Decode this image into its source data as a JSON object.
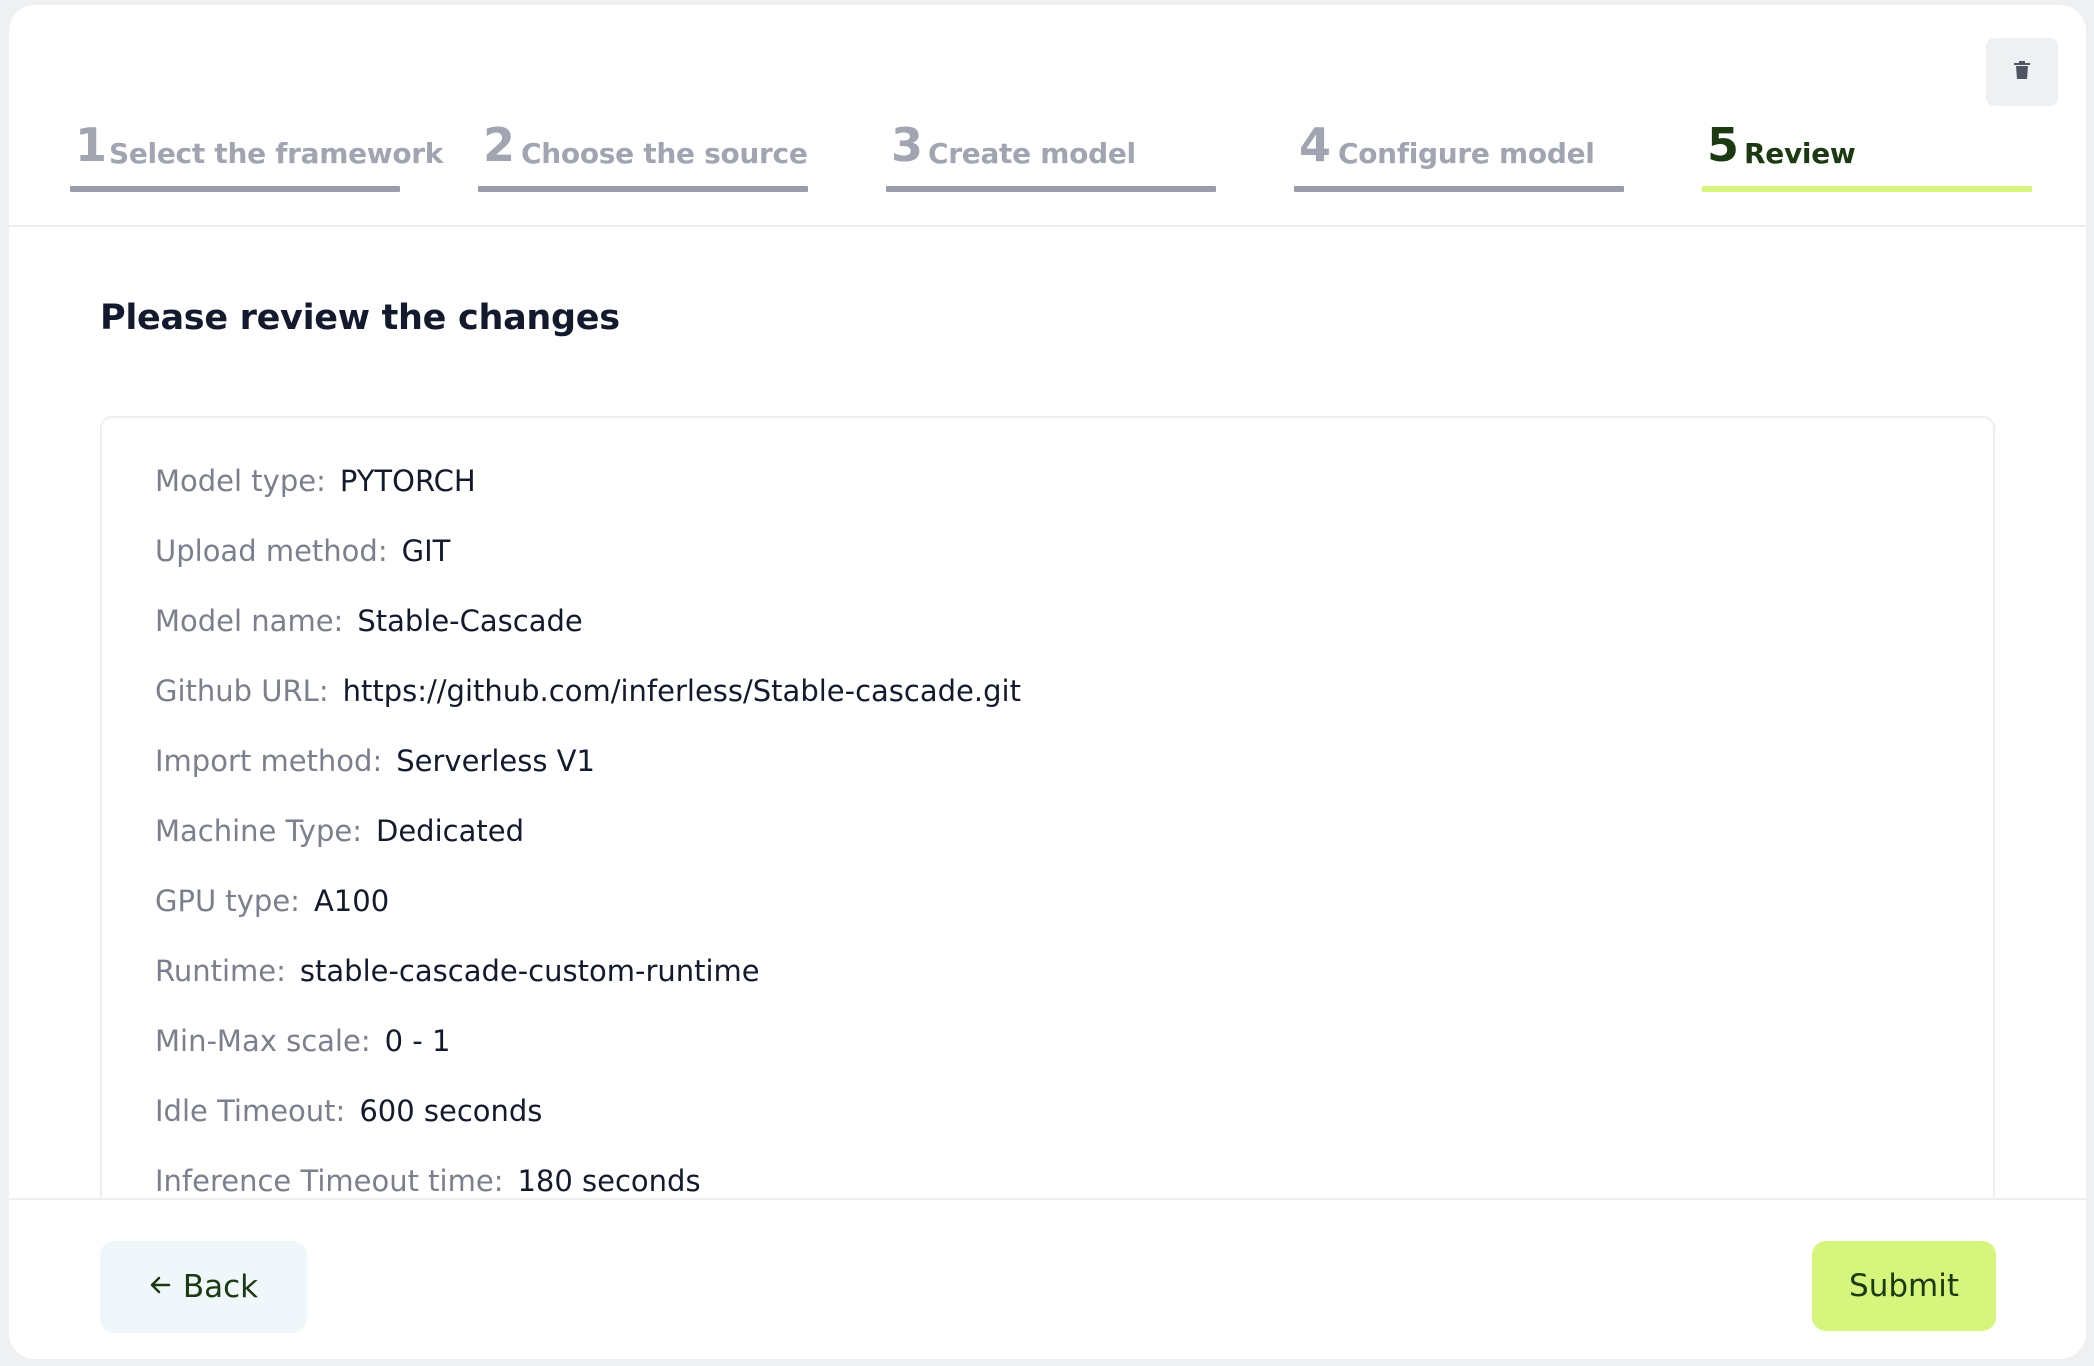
{
  "steps": [
    {
      "number": "1",
      "label": "Select the framework",
      "active": false
    },
    {
      "number": "2",
      "label": "Choose the source",
      "active": false
    },
    {
      "number": "3",
      "label": "Create model",
      "active": false
    },
    {
      "number": "4",
      "label": "Configure model",
      "active": false
    },
    {
      "number": "5",
      "label": "Review",
      "active": true
    }
  ],
  "icons": {
    "delete": "trash-icon",
    "back": "arrow-left-icon"
  },
  "colors": {
    "accent": "#d6f57c",
    "accent_text": "#1c3a12",
    "inactive_step": "#a1a5b2",
    "label_gray": "#7b7f8e"
  },
  "review": {
    "title": "Please review the changes",
    "fields": [
      {
        "key": "Model type:",
        "value": "PYTORCH"
      },
      {
        "key": "Upload method:",
        "value": "GIT"
      },
      {
        "key": "Model name:",
        "value": "Stable-Cascade"
      },
      {
        "key": "Github URL:",
        "value": "https://github.com/inferless/Stable-cascade.git"
      },
      {
        "key": "Import method:",
        "value": "Serverless V1"
      },
      {
        "key": "Machine Type:",
        "value": "Dedicated"
      },
      {
        "key": "GPU type:",
        "value": "A100"
      },
      {
        "key": "Runtime:",
        "value": "stable-cascade-custom-runtime"
      },
      {
        "key": "Min-Max scale:",
        "value": "0 - 1"
      },
      {
        "key": "Idle Timeout:",
        "value": "600 seconds"
      },
      {
        "key": "Inference Timeout time:",
        "value": "180 seconds"
      }
    ]
  },
  "footer": {
    "back_label": "Back",
    "submit_label": "Submit"
  }
}
